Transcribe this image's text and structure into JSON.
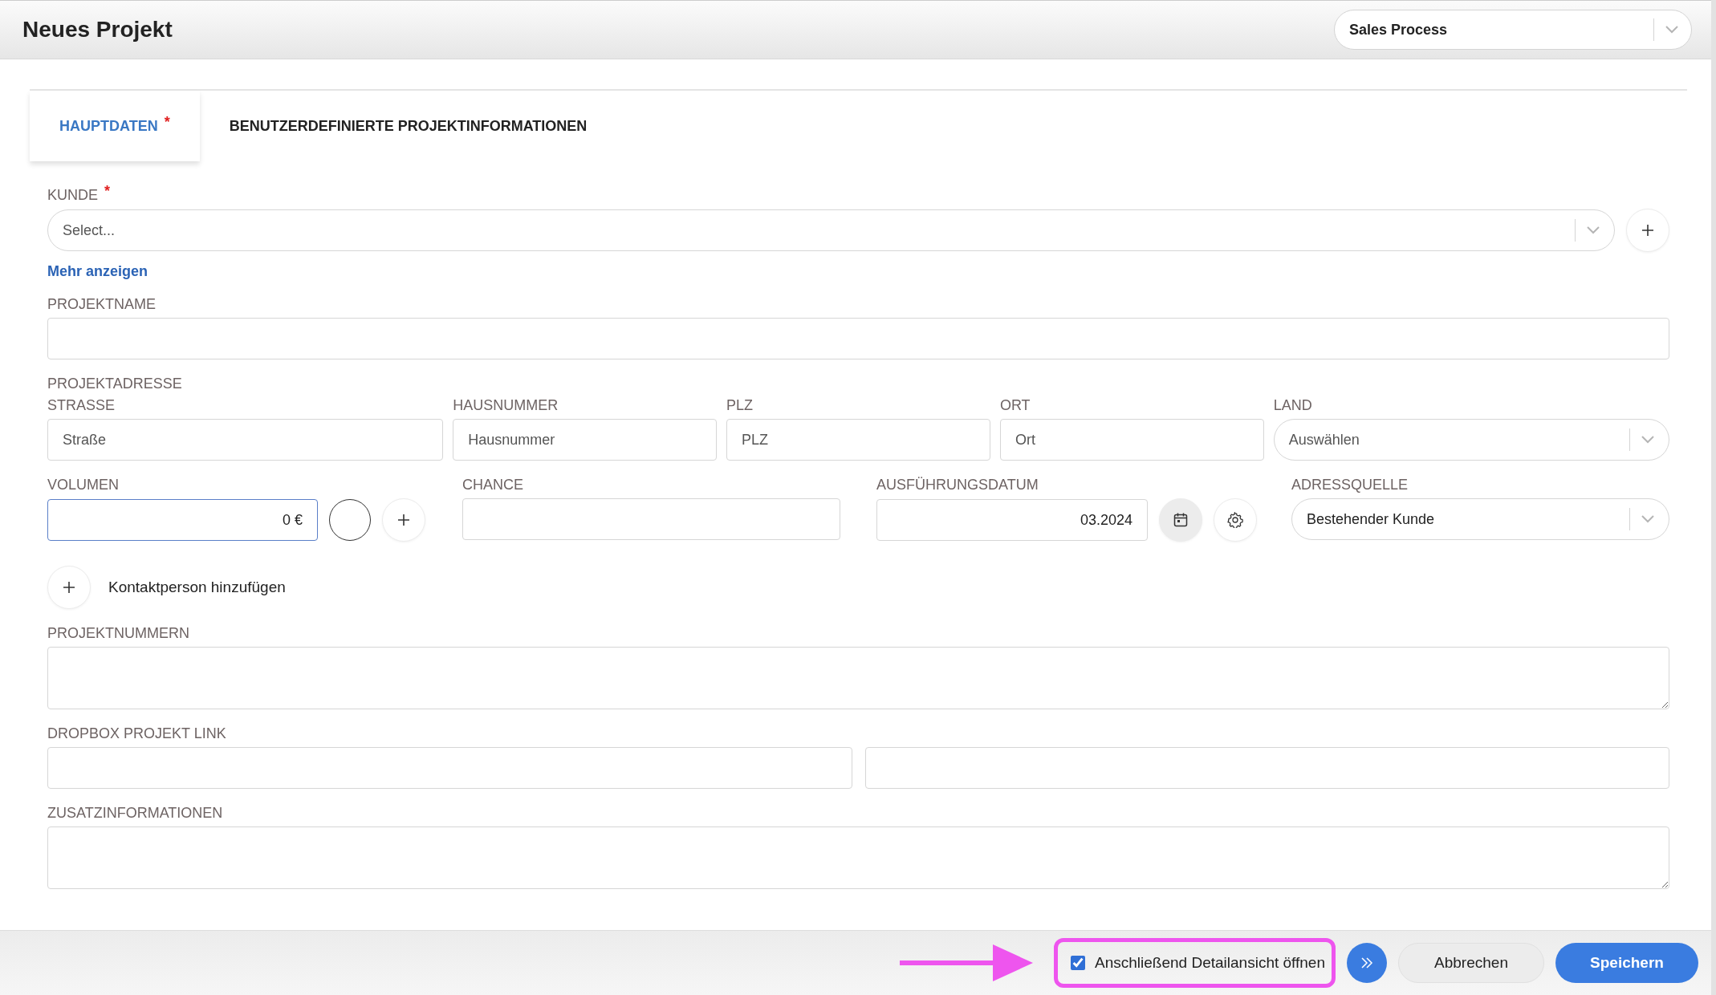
{
  "window": {
    "title": "Neues Projekt"
  },
  "process_select": {
    "value": "Sales Process"
  },
  "tabs": [
    {
      "label": "HAUPTDATEN",
      "mark": "*",
      "selected": true
    },
    {
      "label": "BENUTZERDEFINIERTE PROJEKTINFORMATIONEN",
      "selected": false
    }
  ],
  "customer": {
    "label": "KUNDE",
    "mark": "*",
    "placeholder": "Select..."
  },
  "more_link": "Mehr anzeigen",
  "project_name": {
    "label": "PROJEKTNAME"
  },
  "address": {
    "label": "PROJEKTADRESSE",
    "fields": [
      {
        "label": "STRASSE",
        "placeholder": "Straße",
        "kind": "input"
      },
      {
        "label": "HAUSNUMMER",
        "placeholder": "Hausnummer",
        "kind": "input"
      },
      {
        "label": "PLZ",
        "placeholder": "PLZ",
        "kind": "input"
      },
      {
        "label": "ORT",
        "placeholder": "Ort",
        "kind": "input"
      },
      {
        "label": "LAND",
        "placeholder": "Auswählen",
        "kind": "select"
      }
    ]
  },
  "volume": {
    "label": "VOLUMEN",
    "value": "0 €"
  },
  "chance": {
    "label": "CHANCE"
  },
  "execution_date": {
    "label": "AUSFÜHRUNGSDATUM",
    "value": "03.2024"
  },
  "address_source": {
    "label": "ADRESSQUELLE",
    "value": "Bestehender Kunde"
  },
  "add_contact": {
    "label": "Kontaktperson hinzufügen"
  },
  "project_numbers": {
    "label": "PROJEKTNUMMERN"
  },
  "dropbox_link": {
    "label": "DROPBOX PROJEKT LINK"
  },
  "additional_info": {
    "label": "ZUSATZINFORMATIONEN"
  },
  "footer": {
    "open_detail": {
      "label": "Anschließend Detailansicht öffnen",
      "checked": true
    },
    "buttons": [
      {
        "label": "Abbrechen",
        "kind": "secondary"
      },
      {
        "label": "Speichern",
        "kind": "primary"
      }
    ]
  }
}
